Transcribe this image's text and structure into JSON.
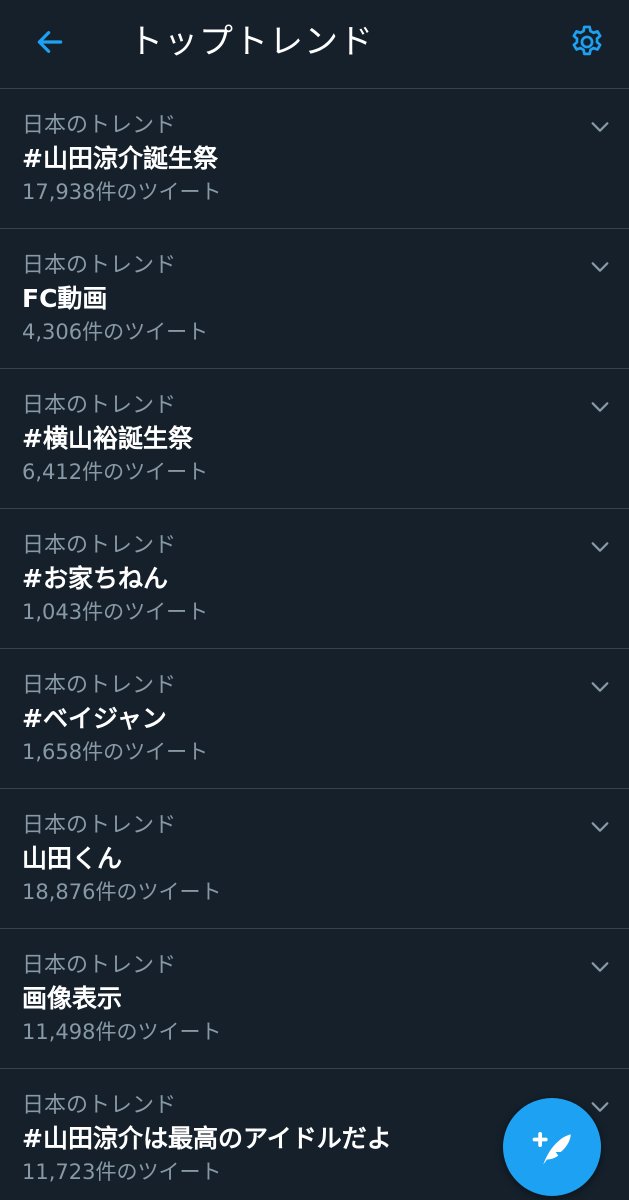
{
  "header": {
    "title": "トップトレンド",
    "back_icon": "arrow-left-icon",
    "settings_icon": "gear-icon"
  },
  "colors": {
    "background": "#15202b",
    "accent": "#1da1f2",
    "muted_text": "#8899a6",
    "divider": "#38444d"
  },
  "trends": [
    {
      "context": "日本のトレンド",
      "name": "#山田涼介誕生祭",
      "count": "17,938件のツイート"
    },
    {
      "context": "日本のトレンド",
      "name": "FC動画",
      "count": "4,306件のツイート"
    },
    {
      "context": "日本のトレンド",
      "name": "#横山裕誕生祭",
      "count": "6,412件のツイート"
    },
    {
      "context": "日本のトレンド",
      "name": "#お家ちねん",
      "count": "1,043件のツイート"
    },
    {
      "context": "日本のトレンド",
      "name": "#ベイジャン",
      "count": "1,658件のツイート"
    },
    {
      "context": "日本のトレンド",
      "name": "山田くん",
      "count": "18,876件のツイート"
    },
    {
      "context": "日本のトレンド",
      "name": "画像表示",
      "count": "11,498件のツイート"
    },
    {
      "context": "日本のトレンド",
      "name": "#山田涼介は最高のアイドルだよ",
      "count": "11,723件のツイート"
    }
  ],
  "fab": {
    "icon": "compose-tweet-icon"
  }
}
